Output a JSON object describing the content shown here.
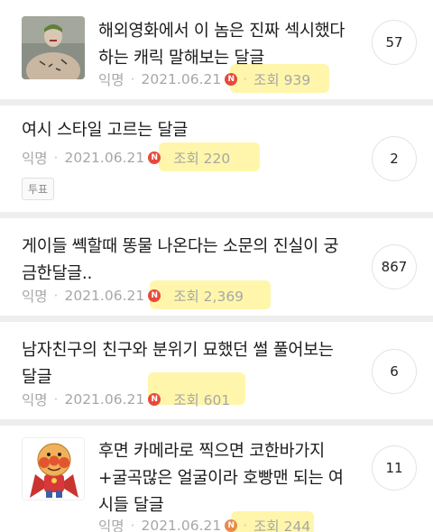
{
  "posts": [
    {
      "title_lines": [
        "해외영화에서 이 놈은 진짜 섹시했다",
        "하는 캐릭 말해보는 달글"
      ],
      "author": "익명",
      "date": "2021.06.21",
      "badge": "N",
      "views": "조회 939",
      "comments": "57",
      "thumb": "joker-photo"
    },
    {
      "title_lines": [
        "여시 스타일 고르는 달글"
      ],
      "author": "익명",
      "date": "2021.06.21",
      "badge": "N",
      "views": "조회 220",
      "comments": "2",
      "tag": "투표"
    },
    {
      "title_lines": [
        "게이들 쎽할때 똥물 나온다는 소문의 진실이 궁",
        "금한달글.."
      ],
      "author": "익명",
      "date": "2021.06.21",
      "badge": "N",
      "views": "조회 2,369",
      "comments": "867"
    },
    {
      "title_lines": [
        "남자친구의 친구와 분위기 묘했던 썰 풀어보는",
        "달글"
      ],
      "author": "익명",
      "date": "2021.06.21",
      "badge": "N",
      "views": "조회 601",
      "comments": "6"
    },
    {
      "title_lines": [
        "후면 카메라로 찍으면 코한바가지",
        "+굴곡많은 얼굴이라 호빵맨 되는 여",
        "시들 달글"
      ],
      "author": "익명",
      "date": "2021.06.21",
      "badge": "N",
      "views": "조회 244",
      "comments": "11",
      "thumb": "anpanman-illustration"
    }
  ]
}
